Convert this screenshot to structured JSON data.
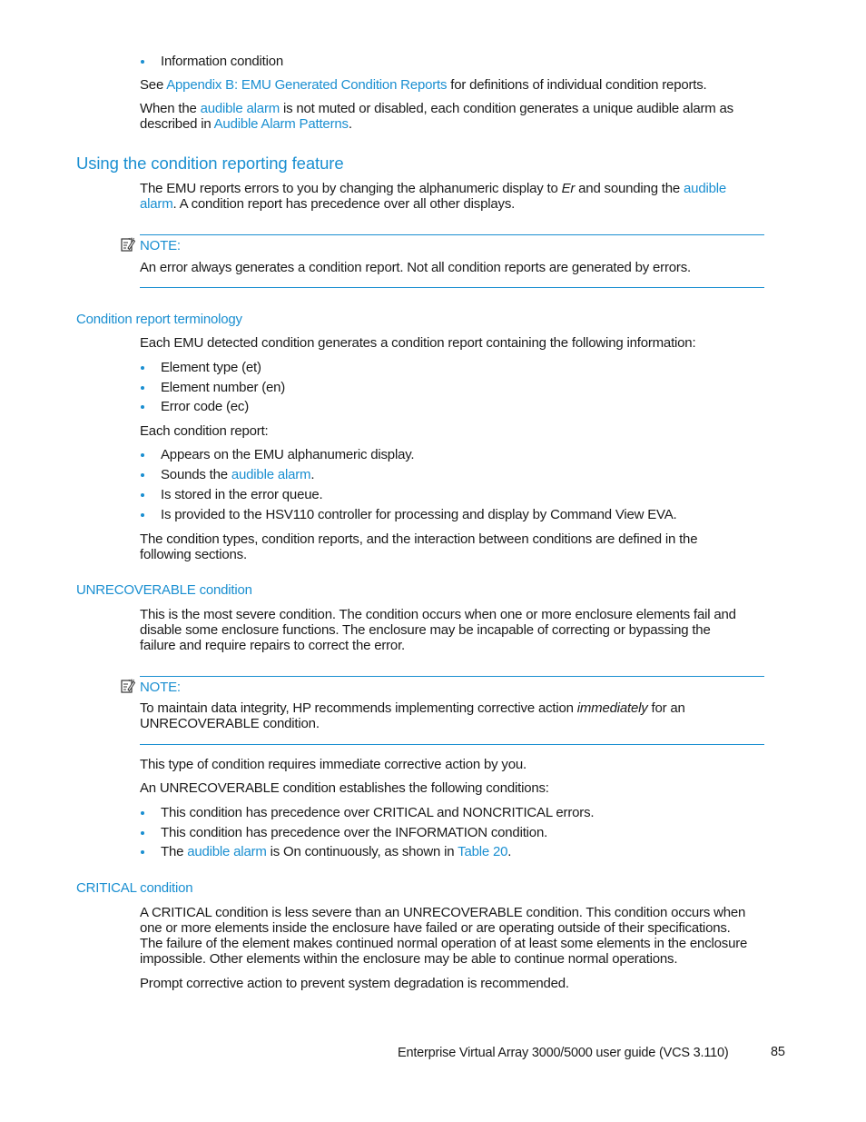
{
  "intro": {
    "bullet_information": "Information condition",
    "see_prefix": "See ",
    "see_link": "Appendix B: EMU Generated Condition Reports",
    "see_suffix": " for definitions of individual condition reports.",
    "when_prefix": "When the ",
    "when_link": "audible alarm",
    "when_mid": " is not muted or disabled, each condition generates a unique audible alarm as",
    "when_line2_prefix": "described in ",
    "when_line2_link": "Audible Alarm Patterns",
    "when_line2_suffix": "."
  },
  "section_using": {
    "heading": "Using the condition reporting feature",
    "p1_prefix": "The EMU reports errors to you by changing the alphanumeric display to ",
    "p1_italic": "Er",
    "p1_mid": " and sounding the ",
    "p1_link_a": "audible",
    "p1_link_b": "alarm",
    "p1_suffix": ".  A condition report has precedence over all other displays.",
    "note_label": "NOTE:",
    "note_text": "An error always generates a condition report.  Not all condition reports are generated by errors."
  },
  "section_terminology": {
    "heading": "Condition report terminology",
    "intro": "Each EMU detected condition generates a condition report containing the following information:",
    "info_items": [
      "Element type (et)",
      "Element number (en)",
      "Error code (ec)"
    ],
    "each_report": "Each condition report:",
    "report_item_1": "Appears on the EMU alphanumeric display.",
    "report_item_2_prefix": "Sounds the ",
    "report_item_2_link": "audible alarm",
    "report_item_2_suffix": ".",
    "report_item_3": "Is stored in the error queue.",
    "report_item_4": "Is provided to the HSV110 controller for processing and display by Command View EVA.",
    "closing_line1": "The condition types, condition reports, and the interaction between conditions are defined in the",
    "closing_line2": "following sections."
  },
  "section_unrecoverable": {
    "heading": "UNRECOVERABLE condition",
    "p1_line1": "This is the most severe condition.  The condition occurs when one or more enclosure elements fail and",
    "p1_line2": "disable some enclosure functions.  The enclosure may be incapable of correcting or bypassing the",
    "p1_line3": "failure and require repairs to correct the error.",
    "note_label": "NOTE:",
    "note_prefix": "To maintain data integrity, HP recommends implementing corrective action ",
    "note_italic": "immediately",
    "note_suffix": " for an",
    "note_line2": "UNRECOVERABLE condition.",
    "p2": "This type of condition requires immediate corrective action by you.",
    "p3": "An UNRECOVERABLE condition establishes the following conditions:",
    "item_1": "This condition has precedence over CRITICAL and NONCRITICAL errors.",
    "item_2": "This condition has precedence over the INFORMATION condition.",
    "item_3_prefix": "The ",
    "item_3_link": "audible alarm",
    "item_3_mid": " is On continuously, as shown in ",
    "item_3_link2": "Table 20",
    "item_3_suffix": "."
  },
  "section_critical": {
    "heading": "CRITICAL condition",
    "p1_line1": "A CRITICAL condition is less severe than an UNRECOVERABLE condition.  This condition occurs when",
    "p1_line2": "one or more elements inside the enclosure have failed or are operating outside of their specifications.",
    "p1_line3": "The failure of the element makes continued normal operation of at least some elements in the enclosure",
    "p1_line4": "impossible.  Other elements within the enclosure may be able to continue normal operations.",
    "p2": "Prompt corrective action to prevent system degradation is recommended."
  },
  "footer": {
    "title": "Enterprise Virtual Array 3000/5000 user guide (VCS 3.110)",
    "page_number": "85"
  }
}
